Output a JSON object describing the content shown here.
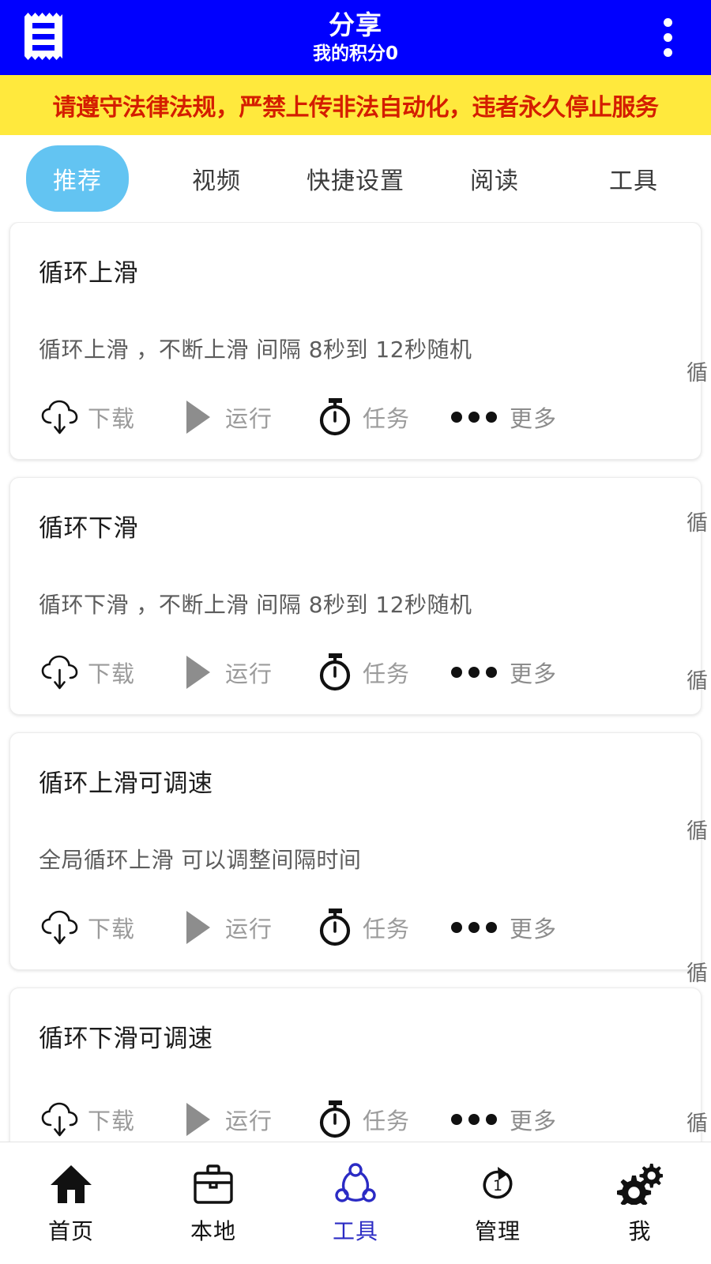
{
  "appbar": {
    "menu_icon": "receipt-icon",
    "title": "分享",
    "subtitle": "我的积分0",
    "overflow_icon": "more-vertical-icon",
    "bg_color": "#0000ff",
    "text_color": "#ffffff"
  },
  "banner": {
    "text": "请遵守法律法规，严禁上传非法自动化，违者永久停止服务",
    "bg_color": "#ffe93d",
    "text_color": "#d41d00"
  },
  "tabs": {
    "active_index": 0,
    "active_bg": "#63c4f2",
    "items": [
      {
        "label": "推荐"
      },
      {
        "label": "视频"
      },
      {
        "label": "快捷设置"
      },
      {
        "label": "阅读"
      },
      {
        "label": "工具"
      }
    ]
  },
  "actions": {
    "download": {
      "label": "下载",
      "icon": "cloud-download-icon"
    },
    "run": {
      "label": "运行",
      "icon": "play-icon"
    },
    "task": {
      "label": "任务",
      "icon": "stopwatch-icon"
    },
    "more": {
      "label": "更多",
      "icon": "ellipsis-icon"
    }
  },
  "cards": [
    {
      "title": "循环上滑",
      "desc": "循环上滑 ，不断上滑 间隔 8秒到 12秒随机"
    },
    {
      "title": "循环下滑",
      "desc": "循环下滑 ，不断上滑 间隔 8秒到 12秒随机"
    },
    {
      "title": "循环上滑可调速",
      "desc": "全局循环上滑 可以调整间隔时间"
    },
    {
      "title": "循环下滑可调速",
      "desc": ""
    }
  ],
  "ghost_column": {
    "char": "循",
    "positions": [
      178,
      368,
      568,
      758,
      938,
      1128
    ]
  },
  "bottomnav": {
    "active_index": 2,
    "active_color": "#2b2bc4",
    "items": [
      {
        "label": "首页",
        "icon": "home-icon"
      },
      {
        "label": "本地",
        "icon": "briefcase-icon"
      },
      {
        "label": "工具",
        "icon": "share-nodes-icon"
      },
      {
        "label": "管理",
        "icon": "repeat-one-icon"
      },
      {
        "label": "我",
        "icon": "gears-icon"
      }
    ]
  }
}
